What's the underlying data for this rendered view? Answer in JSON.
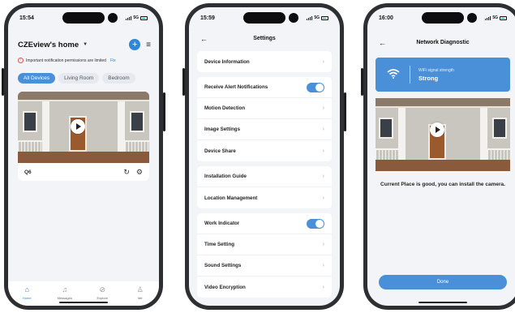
{
  "phone1": {
    "status_time": "15:54",
    "network": "5G",
    "home_title": "CZEview's home",
    "caret_glyph": "▼",
    "add_glyph": "+",
    "menu_glyph": "≡",
    "notice_text": "Important notification permissions are limited",
    "notice_action": "Fix",
    "tabs": [
      "All Devices",
      "Living Room",
      "Bedroom"
    ],
    "camera_name": "Q6",
    "nav": [
      {
        "label": "Home",
        "icon": "home-icon",
        "glyph": "⌂"
      },
      {
        "label": "Messages",
        "icon": "bell-icon",
        "glyph": "♫"
      },
      {
        "label": "Explore",
        "icon": "compass-icon",
        "glyph": "⊘"
      },
      {
        "label": "Me",
        "icon": "person-icon",
        "glyph": "♙"
      }
    ],
    "accent": "#2f86d8"
  },
  "phone2": {
    "status_time": "15:59",
    "network": "5G",
    "back_glyph": "←",
    "title": "Settings",
    "groups": [
      [
        {
          "label": "Device Information",
          "type": "chevron"
        }
      ],
      [
        {
          "label": "Receive Alert Notifications",
          "type": "toggle"
        },
        {
          "label": "Motion Detection",
          "type": "chevron"
        },
        {
          "label": "Image Settings",
          "type": "chevron"
        },
        {
          "label": "Device Share",
          "type": "chevron"
        }
      ],
      [
        {
          "label": "Installation Guide",
          "type": "chevron"
        },
        {
          "label": "Location Management",
          "type": "chevron"
        }
      ],
      [
        {
          "label": "Work Indicator",
          "type": "toggle"
        },
        {
          "label": "Time Setting",
          "type": "chevron"
        },
        {
          "label": "Sound Settings",
          "type": "chevron"
        },
        {
          "label": "Video Encryption",
          "type": "chevron"
        }
      ]
    ]
  },
  "phone3": {
    "status_time": "16:00",
    "network": "5G",
    "back_glyph": "←",
    "title": "Network Diagnostic",
    "signal_label": "WiFi signal strength",
    "signal_value": "Strong",
    "message": "Current Place is good, you can install the camera.",
    "done_label": "Done",
    "card_color": "#4a90d9"
  }
}
